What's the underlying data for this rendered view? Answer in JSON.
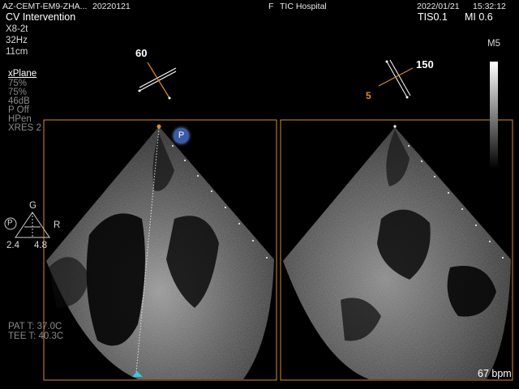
{
  "header": {
    "patient_id": "AZ-CEMT-EM9-ZHA...",
    "study_date": "20220121",
    "sex": "F",
    "hospital": "TIC Hospital",
    "datetime": "2022/01/21",
    "time": "15:32:12",
    "preset": "CV Intervention",
    "tis": "TIS0.1",
    "mi": "MI 0.6"
  },
  "probe": {
    "name": "X8-2t",
    "frame_rate": "32Hz",
    "depth": "11cm"
  },
  "mode": {
    "title": "xPlane",
    "params": [
      "75%",
      "75%",
      "46dB",
      "P Off",
      "HPen",
      "XRES 2"
    ]
  },
  "plane_angles": {
    "primary": "60",
    "secondary": "150",
    "secondary_tilt": "5"
  },
  "orientation": {
    "p": "P",
    "g": "G",
    "r": "R",
    "left_value": "2.4",
    "right_value": "4.8"
  },
  "temps": {
    "pat": "PAT T: 37.0C",
    "tee": "TEE T: 40.3C"
  },
  "grayscale_map": "M5",
  "heart_rate": "67 bpm",
  "colors": {
    "accent_orange": "#d98a2b",
    "marker_cyan": "#35c8e8",
    "p_badge": "#3b5aa8"
  }
}
